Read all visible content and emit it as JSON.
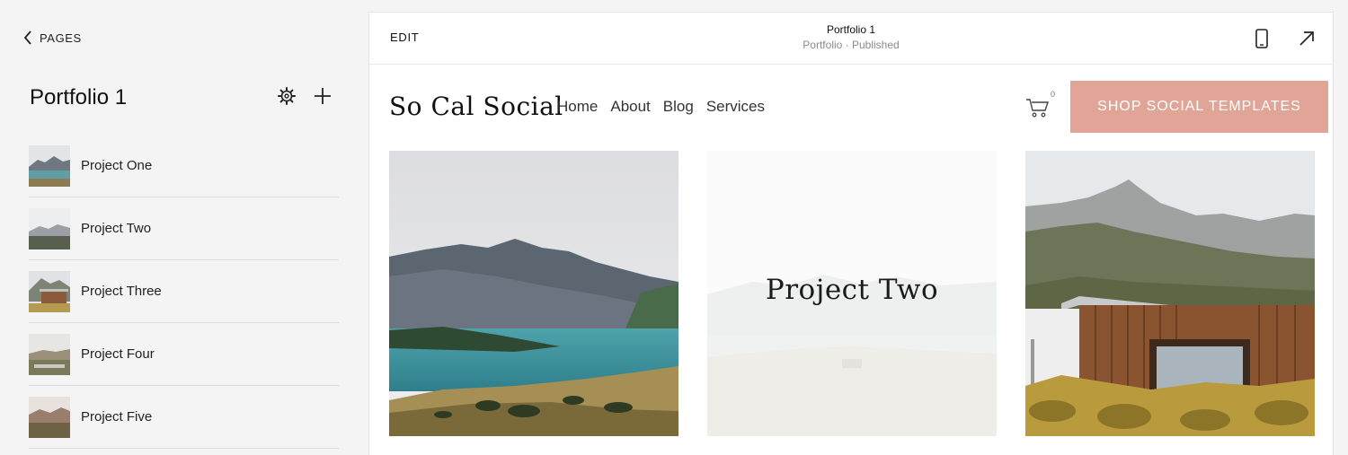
{
  "sidebar": {
    "back_label": "PAGES",
    "title": "Portfolio 1",
    "items": [
      {
        "label": "Project One"
      },
      {
        "label": "Project Two"
      },
      {
        "label": "Project Three"
      },
      {
        "label": "Project Four"
      },
      {
        "label": "Project Five"
      }
    ]
  },
  "preview": {
    "edit_label": "EDIT",
    "doc_title": "Portfolio 1",
    "doc_subtitle": "Portfolio · Published",
    "icons": [
      "mobile-preview-icon",
      "open-external-icon"
    ]
  },
  "site": {
    "logo": "So Cal Social",
    "menu": [
      "Home",
      "About",
      "Blog",
      "Services"
    ],
    "cart_count": "0",
    "cta_label": "SHOP SOCIAL TEMPLATES",
    "cta_color": "#e0a597",
    "gallery_hover_title": "Project Two"
  }
}
